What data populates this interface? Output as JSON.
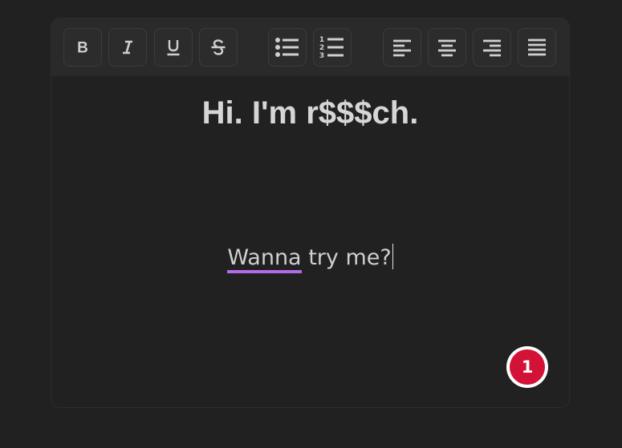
{
  "toolbar": {
    "buttons": [
      {
        "id": "bold",
        "icon": "bold-icon"
      },
      {
        "id": "italic",
        "icon": "italic-icon"
      },
      {
        "id": "underline",
        "icon": "underline-icon"
      },
      {
        "id": "strikethrough",
        "icon": "strikethrough-icon"
      },
      {
        "id": "bulleted-list",
        "icon": "bulleted-list-icon"
      },
      {
        "id": "numbered-list",
        "icon": "numbered-list-icon"
      },
      {
        "id": "align-left",
        "icon": "align-left-icon"
      },
      {
        "id": "align-center",
        "icon": "align-center-icon"
      },
      {
        "id": "align-right",
        "icon": "align-right-icon"
      },
      {
        "id": "align-justify",
        "icon": "align-justify-icon"
      }
    ]
  },
  "document": {
    "heading": "Hi. I'm r$$$ch.",
    "paragraph": {
      "misspelled_word": "Wanna",
      "rest": " try me?"
    }
  },
  "badge": {
    "count": "1"
  },
  "colors": {
    "background": "#212121",
    "toolbar": "#2a2a2a",
    "text": "#d6d6d6",
    "spellcheck_underline": "#b56be8",
    "badge": "#d21237"
  }
}
